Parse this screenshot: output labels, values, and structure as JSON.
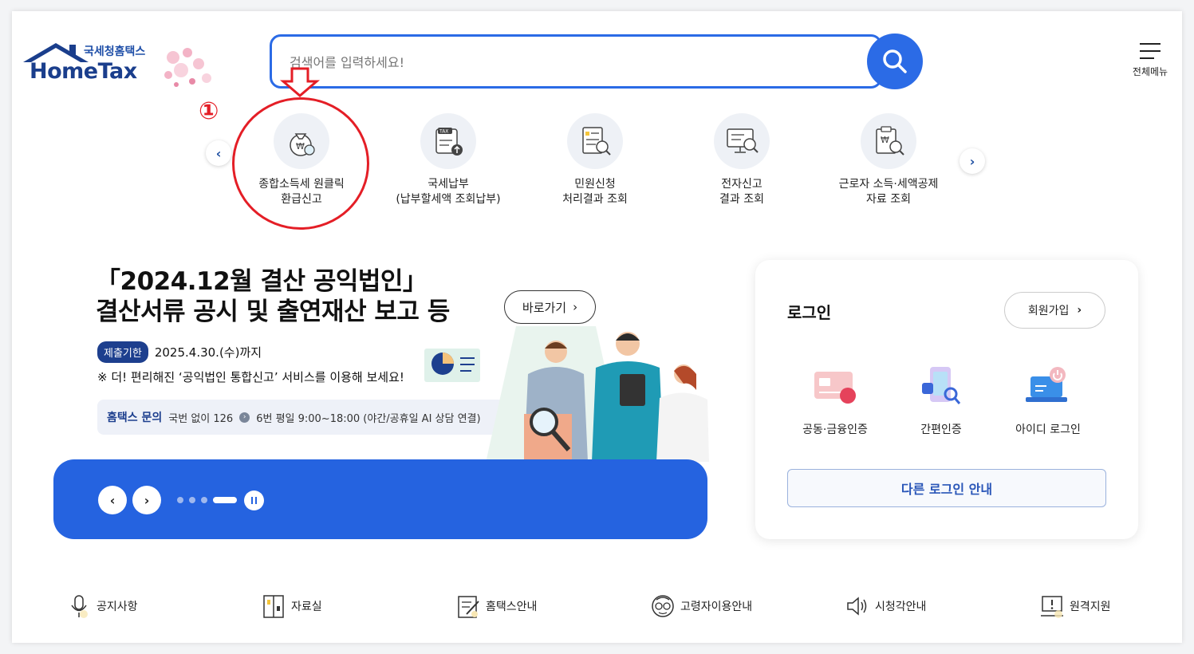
{
  "header": {
    "logo_ko": "국세청홈택스",
    "logo_en": "HomeTax",
    "search_placeholder": "검색어를 입력하세요!",
    "menu_label": "전체메뉴"
  },
  "annotation": {
    "number": "①"
  },
  "quick_menu": [
    {
      "line1": "종합소득세 원클릭",
      "line2": "환급신고",
      "icon": "money-bag-icon"
    },
    {
      "line1": "국세납부",
      "line2": "(납부할세액 조회납부)",
      "icon": "tax-upload-icon"
    },
    {
      "line1": "민원신청",
      "line2": "처리결과 조회",
      "icon": "document-search-icon"
    },
    {
      "line1": "전자신고",
      "line2": "결과 조회",
      "icon": "monitor-search-icon"
    },
    {
      "line1": "근로자 소득·세액공제",
      "line2": "자료 조회",
      "icon": "clipboard-search-icon"
    }
  ],
  "banner": {
    "title_line1": "「2024.12월 결산 공익법인」",
    "title_line2": "결산서류 공시 및 출연재산 보고 등",
    "go_label": "바로가기",
    "deadline_tag": "제출기한",
    "deadline_date": "2025.4.30.(수)까지",
    "notice": "※ 더! 편리해진 ‘공익법인 통합신고’ 서비스를 이용해 보세요!",
    "inquiry_label": "홈택스 문의",
    "inquiry_text_a": "국번 없이 126",
    "inquiry_text_b": "6번 평일 9:00~18:00 (야간/공휴일 AI 상담 연결)"
  },
  "login": {
    "title": "로그인",
    "join_label": "회원가입",
    "options": [
      {
        "label": "공동·금융인증",
        "icon": "certificate-icon"
      },
      {
        "label": "간편인증",
        "icon": "phone-auth-icon"
      },
      {
        "label": "아이디 로그인",
        "icon": "laptop-login-icon"
      }
    ],
    "other_login": "다른 로그인 안내"
  },
  "footer_links": [
    {
      "label": "공지사항",
      "icon": "microphone-icon"
    },
    {
      "label": "자료실",
      "icon": "cabinet-icon"
    },
    {
      "label": "홈택스안내",
      "icon": "notepad-icon"
    },
    {
      "label": "고령자이용안내",
      "icon": "senior-icon"
    },
    {
      "label": "시청각안내",
      "icon": "speaker-icon"
    },
    {
      "label": "원격지원",
      "icon": "remote-support-icon"
    }
  ],
  "colors": {
    "primary": "#2563e0",
    "navy": "#1d3f8e",
    "annotation_red": "#e41e26"
  }
}
